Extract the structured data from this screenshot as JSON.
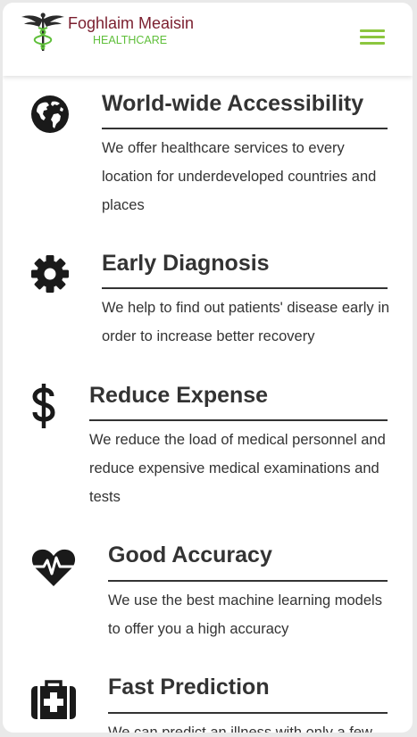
{
  "brand": {
    "name": "Foghlaim Meaisin",
    "tagline": "HEALTHCARE",
    "logo_icon": "caduceus-icon",
    "name_color": "#7a1e2e",
    "tagline_color": "#5fbf3a"
  },
  "header": {
    "menu_icon": "hamburger-menu-icon",
    "menu_color": "#8cc63f"
  },
  "features": [
    {
      "icon": "globe-icon",
      "title": "World-wide Accessibility",
      "description": "We offer healthcare services to every location for underdeveloped countries and places"
    },
    {
      "icon": "gear-icon",
      "title": "Early Diagnosis",
      "description": "We help to find out patients' disease early in order to increase better recovery"
    },
    {
      "icon": "dollar-icon",
      "title": "Reduce Expense",
      "description": "We reduce the load of medical personnel and reduce expensive medical examinations and tests"
    },
    {
      "icon": "heartbeat-icon",
      "title": "Good Accuracy",
      "description": "We use the best machine learning models to offer you a high accuracy"
    },
    {
      "icon": "medical-kit-icon",
      "title": "Fast Prediction",
      "description": "We can predict an illness with only a few"
    }
  ]
}
